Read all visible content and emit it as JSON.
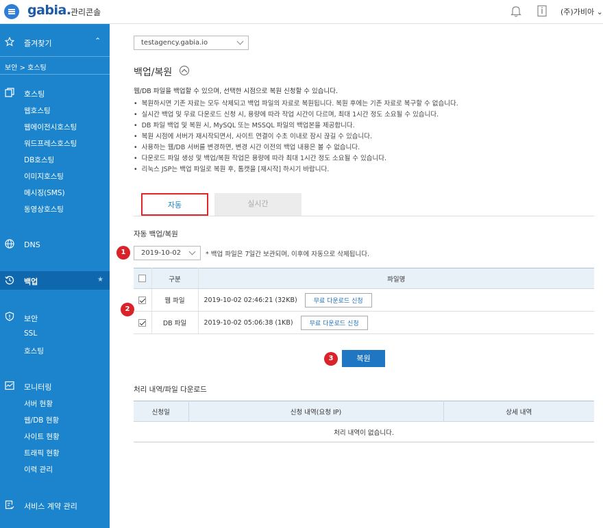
{
  "header": {
    "logo": "gabia.",
    "console_label": "관리콘솔",
    "user_label": "(주)가비아"
  },
  "sidebar": {
    "favorites_label": "즐겨찾기",
    "breadcrumb": "보안 > 호스팅",
    "hosting_label": "호스팅",
    "hosting_items": [
      "웹호스팅",
      "웹에이전시호스팅",
      "워드프레스호스팅",
      "DB호스팅",
      "이미지호스팅",
      "메시징(SMS)",
      "동영상호스팅"
    ],
    "dns_label": "DNS",
    "backup_label": "백업",
    "security_label": "보안",
    "security_items": [
      "SSL",
      "호스팅"
    ],
    "monitoring_label": "모니터링",
    "monitoring_items": [
      "서버 현황",
      "웹/DB 현황",
      "사이트 현황",
      "트래픽 현황",
      "이력 관리"
    ],
    "contract_label": "서비스 계약 관리"
  },
  "main": {
    "domain_select": "testagency.gabia.io",
    "page_title": "백업/복원",
    "description": "웹/DB 파일을 백업할 수 있으며, 선택한 시점으로 복원 신청할 수 있습니다.",
    "notes": [
      "복원하시면 기존 자료는 모두 삭제되고 백업 파일의 자료로 복원됩니다. 복원 후에는 기존 자료로 복구할 수 없습니다.",
      "실시간 백업 및 무료 다운로드 신청 시, 용량에 따라 작업 시간이 다르며, 최대 1시간 정도 소요될 수 있습니다.",
      "DB 파일 백업 및 복원 시, MySQL 또는 MSSQL 파일의 백업본을 제공합니다.",
      "복원 시점에 서버가 재시작되면서, 사이트 연결이 수초 이내로 잠시 끊길 수 있습니다.",
      "사용하는 웹/DB 서버를 변경하면, 변경 시간 이전의 백업 내용은 볼 수 없습니다.",
      "다운로드 파일 생성 및 백업/복원 작업은 용량에 따라 최대 1시간 정도 소요될 수 있습니다.",
      "리눅스 JSP는 백업 파일로 복원 후, 톰캣을 [재시작] 하시기 바랍니다."
    ],
    "tabs": {
      "auto": "자동",
      "realtime": "실시간"
    },
    "auto_section_title": "자동 백업/복원",
    "badges": [
      "1",
      "2",
      "3"
    ],
    "date_select": "2019-10-02",
    "date_note": "* 백업 파일은 7일간 보관되며, 이후에 자동으로 삭제됩니다.",
    "backup_table": {
      "headers": {
        "type": "구분",
        "filename": "파일명"
      },
      "rows": [
        {
          "type": "웹 파일",
          "file": "2019-10-02 02:46:21 (32KB)",
          "button": "무료 다운로드 신청"
        },
        {
          "type": "DB 파일",
          "file": "2019-10-02 05:06:38 (1KB)",
          "button": "무료 다운로드 신청"
        }
      ]
    },
    "restore_button": "복원",
    "history_title": "처리 내역/파일 다운로드",
    "history_table": {
      "headers": [
        "신청일",
        "신청 내역(요청 IP)",
        "상세 내역"
      ],
      "empty": "처리 내역이 없습니다."
    }
  }
}
